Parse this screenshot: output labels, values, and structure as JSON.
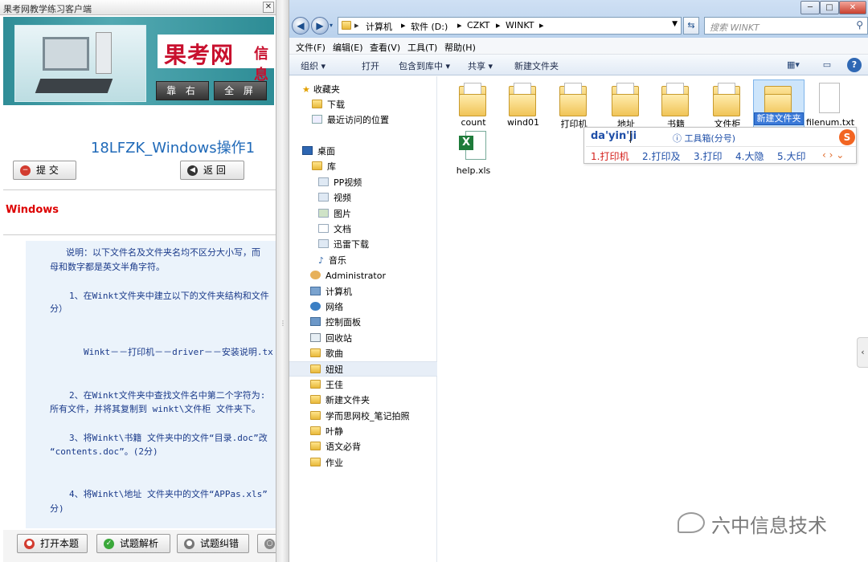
{
  "left_window": {
    "title": "果考网教学练习客户端",
    "close_label": "✕",
    "logo_text": "果考网",
    "logo_suffix": "信息",
    "banner_buttons": [
      "靠 右",
      "全 屏"
    ],
    "exam_title": "18LFZK_Windows操作1",
    "submit_label": "提 交",
    "back_label": "返 回",
    "section_label": "Windows",
    "question_number": "1、",
    "question_lines": [
      "说明：以下文件名及文件夹名均不区分大小写，而",
      "母和数字都是英文半角字符。",
      "1、在Winkt文件夹中建立以下的文件夹结构和文件",
      "分）",
      "Winkt－－打印机－－driver－－安装说明.tx",
      "2、在Winkt文件夹中查找文件名中第二个字符为:",
      "所有文件，并将其复制到 winkt\\文件柜 文件夹下。",
      "3、将Winkt\\书籍 文件夹中的文件“目录.doc”改",
      "“contents.doc”。(2分)",
      "4、将Winkt\\地址 文件夹中的文件“APPas.xls”",
      "分)"
    ],
    "bottom_buttons": [
      "打开本题",
      "试题解析",
      "试题纠错"
    ]
  },
  "explorer": {
    "window_controls": [
      "─",
      "□",
      "✕"
    ],
    "breadcrumb": [
      "计算机",
      "软件 (D:)",
      "CZKT",
      "WINKT"
    ],
    "search_placeholder": "搜索 WINKT",
    "menu": [
      "文件(F)",
      "编辑(E)",
      "查看(V)",
      "工具(T)",
      "帮助(H)"
    ],
    "toolbar": [
      "组织 ▾",
      "打开",
      "包含到库中 ▾",
      "共享 ▾",
      "新建文件夹"
    ],
    "nav": [
      "收藏夹",
      "下载",
      "最近访问的位置",
      "桌面",
      "库",
      "PP视频",
      "视频",
      "图片",
      "文档",
      "迅雷下载",
      "音乐",
      "Administrator",
      "计算机",
      "网络",
      "控制面板",
      "回收站",
      "歌曲",
      "妞妞",
      "王佳",
      "新建文件夹",
      "学而思网校_笔记拍照",
      "叶静",
      "语文必背",
      "作业"
    ],
    "files": [
      "count",
      "wind01",
      "打印机",
      "地址",
      "书籍",
      "文件柜",
      "新建文件夹",
      "filenum.txt",
      "help.xls"
    ],
    "ime": {
      "composition": "da'yin'ji",
      "toolbox": "ⓘ 工具箱(分号)",
      "logo": "S",
      "candidates": [
        "1.打印机",
        "2.打印及",
        "3.打印",
        "4.大隐",
        "5.大印"
      ],
      "arrows": "‹ › ⌄"
    },
    "watermark": "六中信息技术"
  }
}
